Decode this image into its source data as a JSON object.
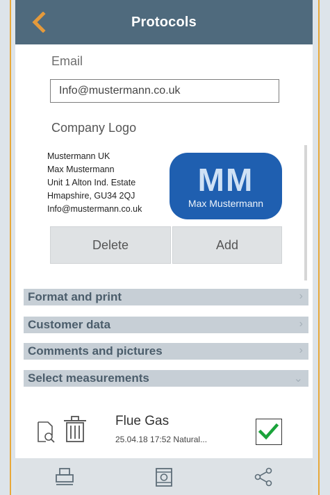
{
  "header": {
    "title": "Protocols",
    "back_icon": "chevron-left-icon"
  },
  "email": {
    "label": "Email",
    "value": "Info@mustermann.co.uk"
  },
  "company_logo": {
    "label": "Company Logo",
    "address_lines": [
      "Mustermann UK",
      "Max Mustermann",
      "Unit 1 Alton Ind. Estate",
      "Hmapshire, GU34 2QJ",
      "Info@mustermann.co.uk"
    ],
    "logo_initials": "MM",
    "logo_name": "Max Mustermann"
  },
  "buttons": {
    "delete_label": "Delete",
    "add_label": "Add"
  },
  "sections": [
    {
      "label": "Format and print",
      "icon": "chevron-right-icon"
    },
    {
      "label": "Customer data",
      "icon": "chevron-right-icon"
    },
    {
      "label": "Comments and pictures",
      "icon": "chevron-right-icon"
    },
    {
      "label": "Select measurements",
      "icon": "chevron-down-icon"
    }
  ],
  "measurement": {
    "title": "Flue Gas",
    "subtitle": "25.04.18  17:52  Natural...",
    "checked": true
  },
  "bottom_bar": [
    "print-icon",
    "report-icon",
    "share-icon"
  ],
  "colors": {
    "header_bg": "#4f6a7d",
    "back_accent": "#e59a3b",
    "logo_bg": "#1f5fb0",
    "section_bg": "#c7cfd6",
    "check_green": "#1aa33a"
  }
}
